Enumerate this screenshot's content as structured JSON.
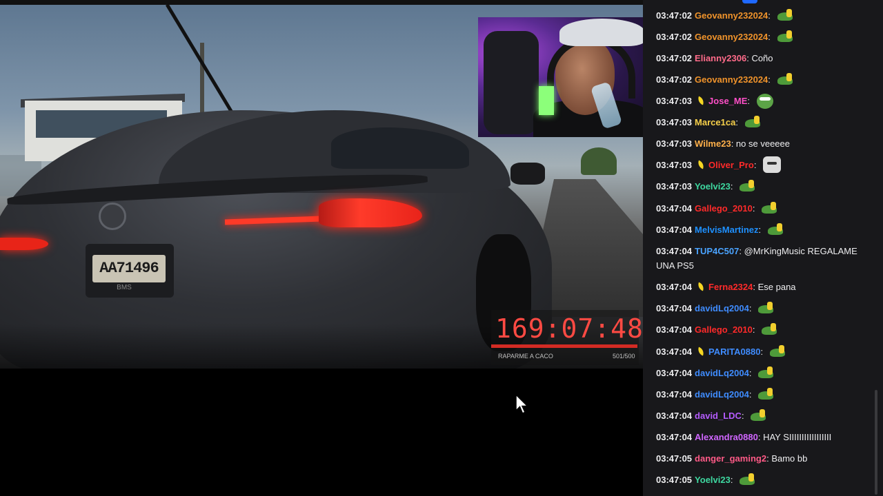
{
  "stream": {
    "license_plate": "AA71496",
    "plate_model": "BMS",
    "timer": {
      "value": "169:07:48",
      "label": "RAPARME A CACO",
      "count": "501/500",
      "progress_fraction": 1.0,
      "color": "#ff4a43"
    }
  },
  "chat": {
    "background": "#18181b",
    "messages": [
      {
        "time": "03:47:02",
        "badge": false,
        "user": "Geovanny232024",
        "color": "#f0932b",
        "text": "",
        "emote": "frog"
      },
      {
        "time": "03:47:02",
        "badge": false,
        "user": "Geovanny232024",
        "color": "#f0932b",
        "text": "",
        "emote": "frog"
      },
      {
        "time": "03:47:02",
        "badge": false,
        "user": "Elianny2306",
        "color": "#ff6b8a",
        "text": "Coño",
        "emote": ""
      },
      {
        "time": "03:47:02",
        "badge": false,
        "user": "Geovanny232024",
        "color": "#f0932b",
        "text": "",
        "emote": "frog"
      },
      {
        "time": "03:47:03",
        "badge": true,
        "user": "Jose_ME",
        "color": "#ff4fc8",
        "text": "",
        "emote": "pepe"
      },
      {
        "time": "03:47:03",
        "badge": false,
        "user": "Marce1ca",
        "color": "#f7d04a",
        "text": "",
        "emote": "frog"
      },
      {
        "time": "03:47:03",
        "badge": false,
        "user": "Wilme23",
        "color": "#ffb04a",
        "text": "no se veeeee",
        "emote": ""
      },
      {
        "time": "03:47:03",
        "badge": true,
        "user": "Oliver_Pro",
        "color": "#ff2a2a",
        "text": "",
        "emote": "cat"
      },
      {
        "time": "03:47:03",
        "badge": false,
        "user": "Yoelvi23",
        "color": "#3ed8a0",
        "text": "",
        "emote": "frog"
      },
      {
        "time": "03:47:04",
        "badge": false,
        "user": "Gallego_2010",
        "color": "#ff2a2a",
        "text": "",
        "emote": "frog"
      },
      {
        "time": "03:47:04",
        "badge": false,
        "user": "MelvisMartinez",
        "color": "#1e90ff",
        "text": "",
        "emote": "frog"
      },
      {
        "time": "03:47:04",
        "badge": false,
        "user": "TUP4C507",
        "color": "#4aa3ff",
        "text": "@MrKingMusic REGALAME UNA PS5",
        "emote": ""
      },
      {
        "time": "03:47:04",
        "badge": true,
        "user": "Ferna2324",
        "color": "#ff2a2a",
        "text": "Ese pana",
        "emote": ""
      },
      {
        "time": "03:47:04",
        "badge": false,
        "user": "davidLq2004",
        "color": "#3f8cff",
        "text": "",
        "emote": "frog"
      },
      {
        "time": "03:47:04",
        "badge": false,
        "user": "Gallego_2010",
        "color": "#ff2a2a",
        "text": "",
        "emote": "frog"
      },
      {
        "time": "03:47:04",
        "badge": true,
        "user": "PARITA0880",
        "color": "#3f8cff",
        "text": "",
        "emote": "frog"
      },
      {
        "time": "03:47:04",
        "badge": false,
        "user": "davidLq2004",
        "color": "#3f8cff",
        "text": "",
        "emote": "frog"
      },
      {
        "time": "03:47:04",
        "badge": false,
        "user": "davidLq2004",
        "color": "#3f8cff",
        "text": "",
        "emote": "frog"
      },
      {
        "time": "03:47:04",
        "badge": false,
        "user": "david_LDC",
        "color": "#b55cff",
        "text": "",
        "emote": "frog"
      },
      {
        "time": "03:47:04",
        "badge": false,
        "user": "Alexandra0880",
        "color": "#d066ff",
        "text": "HAY SIIIIIIIIIIIIIIIII",
        "emote": ""
      },
      {
        "time": "03:47:05",
        "badge": false,
        "user": "danger_gaming2",
        "color": "#ff5a87",
        "text": "Bamo bb",
        "emote": ""
      },
      {
        "time": "03:47:05",
        "badge": false,
        "user": "Yoelvi23",
        "color": "#3ed8a0",
        "text": "",
        "emote": "frog"
      }
    ]
  }
}
